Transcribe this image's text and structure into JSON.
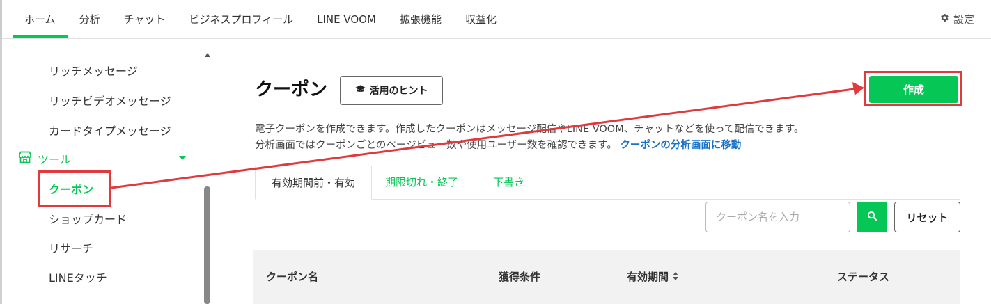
{
  "topnav": {
    "tabs": [
      "ホーム",
      "分析",
      "チャット",
      "ビジネスプロフィール",
      "LINE VOOM",
      "拡張機能",
      "収益化"
    ],
    "active_tab": "ホーム",
    "settings_label": "設定"
  },
  "sidebar": {
    "items_above": [
      "リッチメッセージ",
      "リッチビデオメッセージ",
      "カードタイプメッセージ"
    ],
    "section_label": "ツール",
    "tool_items": [
      "クーポン",
      "ショップカード",
      "リサーチ",
      "LINEタッチ"
    ],
    "active_item": "クーポン"
  },
  "main": {
    "title": "クーポン",
    "hint_button": "活用のヒント",
    "create_button": "作成",
    "desc_line1": "電子クーポンを作成できます。作成したクーポンはメッセージ配信やLINE VOOM、チャットなどを使って配信できます。",
    "desc_line2": "分析画面ではクーポンごとのページビュー数や使用ユーザー数を確認できます。",
    "desc_link": "クーポンの分析画面に移動",
    "tabs": [
      "有効期間前・有効",
      "期限切れ・終了",
      "下書き"
    ],
    "search_placeholder": "クーポン名を入力",
    "reset_button": "リセット",
    "table_headers": [
      "クーポン名",
      "獲得条件",
      "有効期間",
      "ステータス"
    ]
  },
  "colors": {
    "brand_green": "#06c755",
    "highlight_red": "#e0393e",
    "link_blue": "#1a73c8"
  }
}
